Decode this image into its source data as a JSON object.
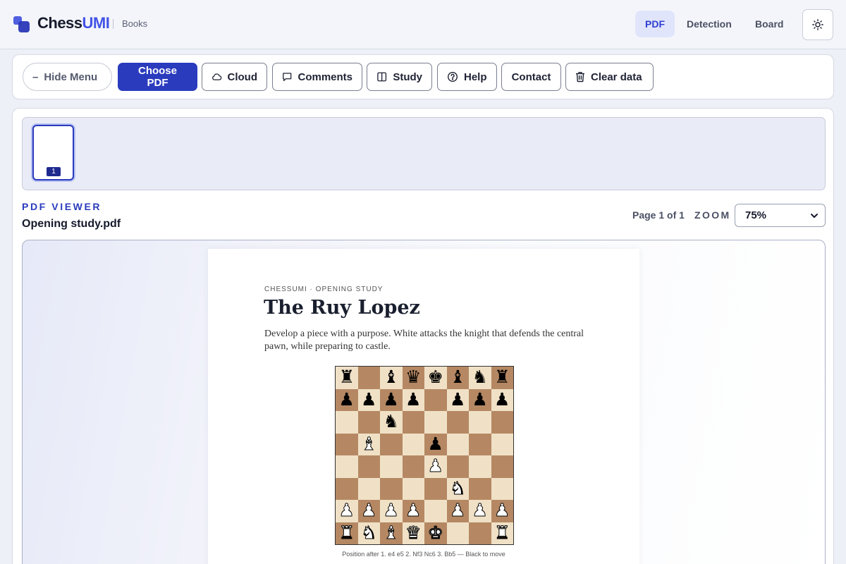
{
  "header": {
    "brand_main": "Chess",
    "brand_accent": "UMI",
    "brand_sub": "Books",
    "tabs": [
      {
        "label": "PDF",
        "active": true
      },
      {
        "label": "Detection",
        "active": false
      },
      {
        "label": "Board",
        "active": false
      }
    ],
    "theme_icon": "sun-icon"
  },
  "toolbar": {
    "hide_menu": "Hide Menu",
    "choose_pdf": "Choose PDF",
    "cloud": "Cloud",
    "comments": "Comments",
    "study": "Study",
    "help": "Help",
    "contact": "Contact",
    "clear_data": "Clear data"
  },
  "thumbnails": [
    {
      "page": "1",
      "selected": true
    }
  ],
  "viewer": {
    "kicker": "PDF VIEWER",
    "file_name": "Opening study.pdf",
    "page_info": "Page 1 of 1",
    "zoom_label": "ZOOM",
    "zoom_value": "75%"
  },
  "document": {
    "kicker": "CHESSUMI · OPENING STUDY",
    "title": "The Ruy Lopez",
    "description": "Develop a piece with a purpose. White attacks the knight that defends the central pawn, while preparing to castle.",
    "board_rows": [
      [
        "r",
        "",
        "b",
        "q",
        "k",
        "b",
        "n",
        "r"
      ],
      [
        "p",
        "p",
        "p",
        "p",
        "",
        "p",
        "p",
        "p"
      ],
      [
        "",
        "",
        "n",
        "",
        "",
        "",
        "",
        ""
      ],
      [
        "",
        "B",
        "",
        "",
        "p",
        "",
        "",
        ""
      ],
      [
        "",
        "",
        "",
        "",
        "P",
        "",
        "",
        ""
      ],
      [
        "",
        "",
        "",
        "",
        "",
        "N",
        "",
        ""
      ],
      [
        "P",
        "P",
        "P",
        "P",
        "",
        "P",
        "P",
        "P"
      ],
      [
        "R",
        "N",
        "B",
        "Q",
        "K",
        "",
        "",
        "R"
      ]
    ],
    "caption": "Position after 1. e4 e5 2. Nf3 Nc6 3. Bb5 — Black to move"
  },
  "colors": {
    "accent": "#2a3bbd",
    "brand_accent": "#4353e6",
    "board_light": "#f0e1c6",
    "board_dark": "#b58863"
  }
}
